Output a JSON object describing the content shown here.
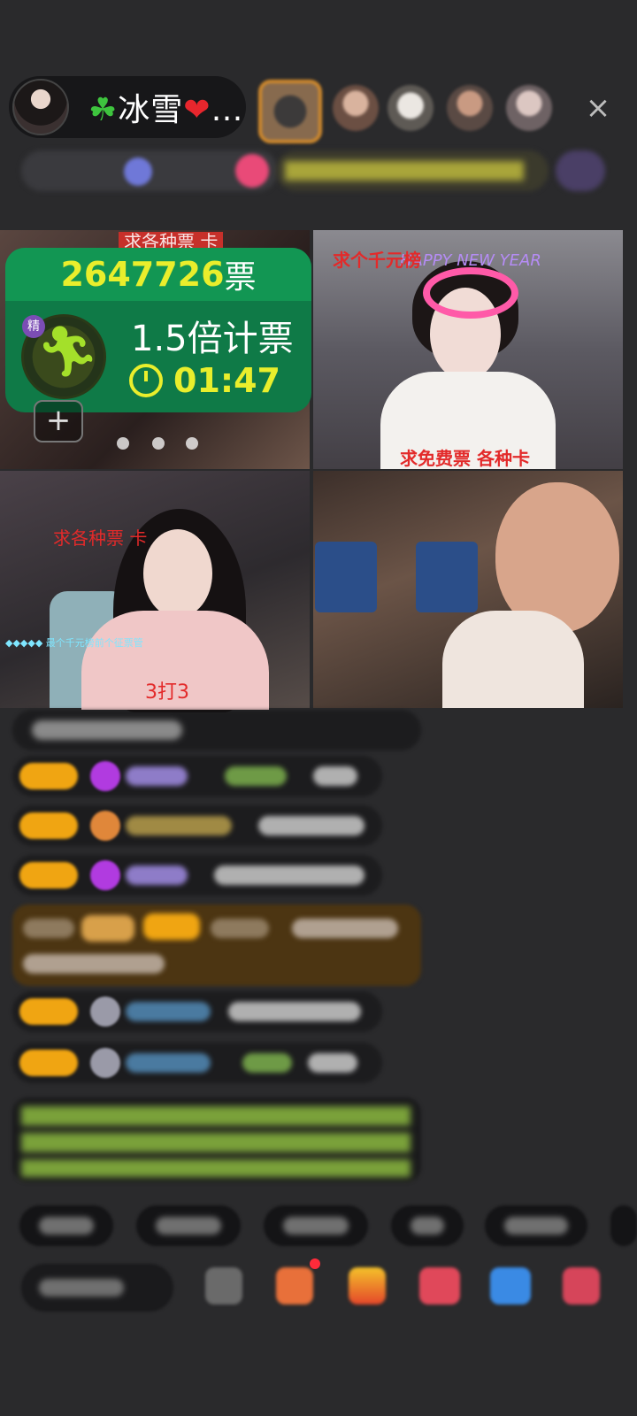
{
  "header": {
    "host_name": "冰雪",
    "host_name_prefix_icon": "clover-icon",
    "host_name_suffix_icon": "heart-icon",
    "host_name_ellipsis": "…",
    "close_label": "×"
  },
  "vote_card": {
    "count": "2647726",
    "unit": "票",
    "multiplier": "1.5倍计票",
    "timer": "01:47",
    "badge_tag": "精",
    "add_label": "+"
  },
  "tiles": {
    "t1_label": "求各种票 卡",
    "t2_top_label": "求个千元榜",
    "t2_neon": "HAPPY NEW YEAR",
    "t2_bottom_label": "求免费票 各种卡",
    "t3_top_label": "求各种票 卡",
    "t3_small_label": "◆◆◆◆◆ 最个千元榜前个征票管",
    "t3_score": "3打3"
  },
  "colors": {
    "vote_green": "#0f7a47",
    "vote_yellow": "#e9ee2c",
    "accent_red": "#e32a2a",
    "chip_orange": "#f0a512"
  }
}
